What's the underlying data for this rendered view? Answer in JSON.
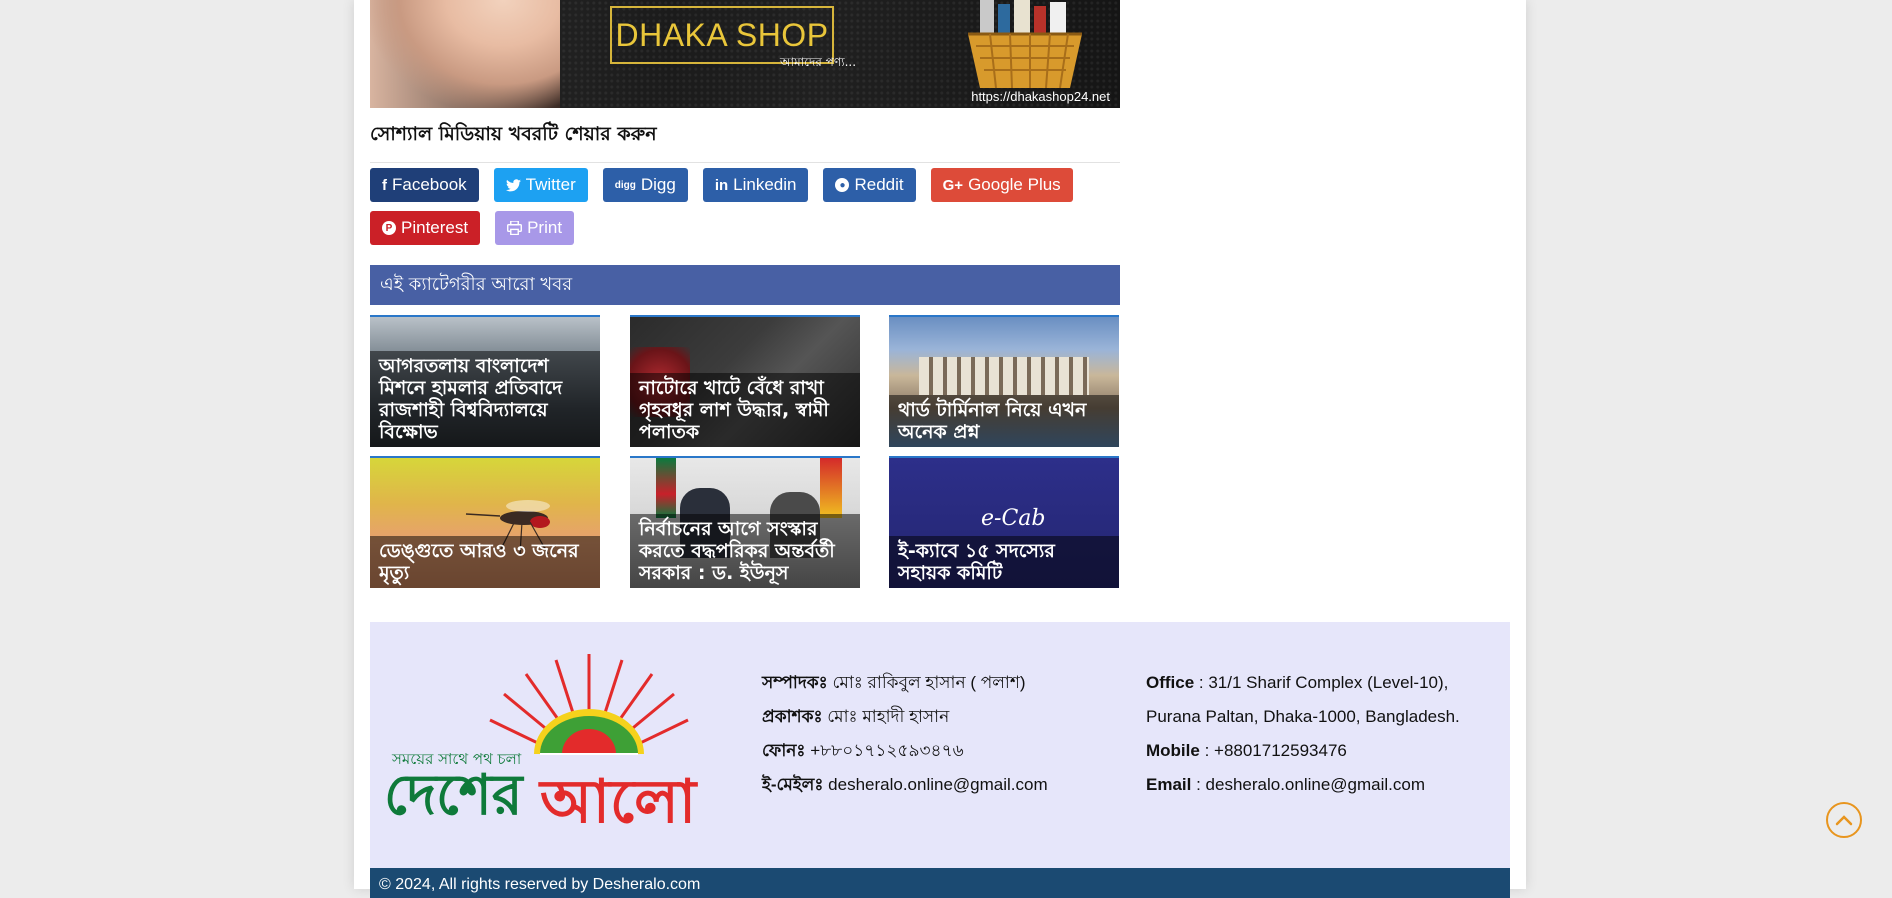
{
  "banner": {
    "logo_text": "DHAKA SHOP",
    "tagline": "আমাদের পণ্য...",
    "url": "https://dhakashop24.net"
  },
  "share": {
    "title": "সোশ্যাল মিডিয়ায় খবরটি শেয়ার করুন",
    "buttons": [
      {
        "label": "Facebook",
        "icon": "facebook-icon",
        "color": "#1f3f78"
      },
      {
        "label": "Twitter",
        "icon": "twitter-icon",
        "color": "#1da1f2"
      },
      {
        "label": "Digg",
        "icon": "digg-icon",
        "color": "#2d5fa8"
      },
      {
        "label": "Linkedin",
        "icon": "linkedin-icon",
        "color": "#2d5fa8"
      },
      {
        "label": "Reddit",
        "icon": "reddit-icon",
        "color": "#2d5fa8"
      },
      {
        "label": "Google Plus",
        "icon": "google-plus-icon",
        "color": "#dd4b39"
      },
      {
        "label": "Pinterest",
        "icon": "pinterest-icon",
        "color": "#cb2027"
      },
      {
        "label": "Print",
        "icon": "print-icon",
        "color": "#a898e8"
      }
    ]
  },
  "category": {
    "header": "এই ক্যাটেগরীর আরো খবর",
    "news": [
      {
        "title": "আগরতলায় বাংলাদেশ মিশনে হামলার প্রতিবাদে রাজশাহী বিশ্ববিদ্যালয়ে বিক্ষোভ"
      },
      {
        "title": "নাটোরে খাটে বেঁধে রাখা গৃহবধূর লাশ উদ্ধার, স্বামী পলাতক"
      },
      {
        "title": "থার্ড টার্মিনাল নিয়ে এখন অনেক প্রশ্ন"
      },
      {
        "title": "ডেঙ্গুতে আরও ৩ জনের মৃত্যু"
      },
      {
        "title": "নির্বাচনের আগে সংস্কার করতে বদ্ধপরিকর অন্তর্বর্তী সরকার : ড. ইউনূস"
      },
      {
        "title": "ই-ক্যাবে ১৫ সদস্যের সহায়ক কমিটি"
      }
    ]
  },
  "footer": {
    "logo": {
      "slogan": "সময়ের সাথে পথ চলা",
      "name_part1": "দেশের",
      "name_part2": "আলো"
    },
    "editor_label": "সম্পাদকঃ",
    "editor_value": "মোঃ রাকিবুল হাসান ( পলাশ)",
    "publisher_label": "প্রকাশকঃ",
    "publisher_value": "মোঃ মাহাদী হাসান",
    "phone_label": "ফোনঃ",
    "phone_value": "+৮৮০১৭১২৫৯৩৪৭৬",
    "email_label_bn": "ই-মেইলঃ",
    "email_value_bn": "desheralo.online@gmail.com",
    "office_label": "Office",
    "office_value_1": " : 31/1 Sharif Complex (Level-10),",
    "office_value_2": "Purana Paltan, Dhaka-1000, Bangladesh.",
    "mobile_label": "Mobile",
    "mobile_value": " : +8801712593476",
    "email_label": "Email",
    "email_value": " : desheralo.online@gmail.com",
    "copyright": "© 2024, All rights reserved by Desheralo.com"
  },
  "colors": {
    "category_header": "#4860a4",
    "footer_bg": "#e6e6fa",
    "copyright_bg": "#1b4a72",
    "scroll_top": "#e8951e"
  }
}
